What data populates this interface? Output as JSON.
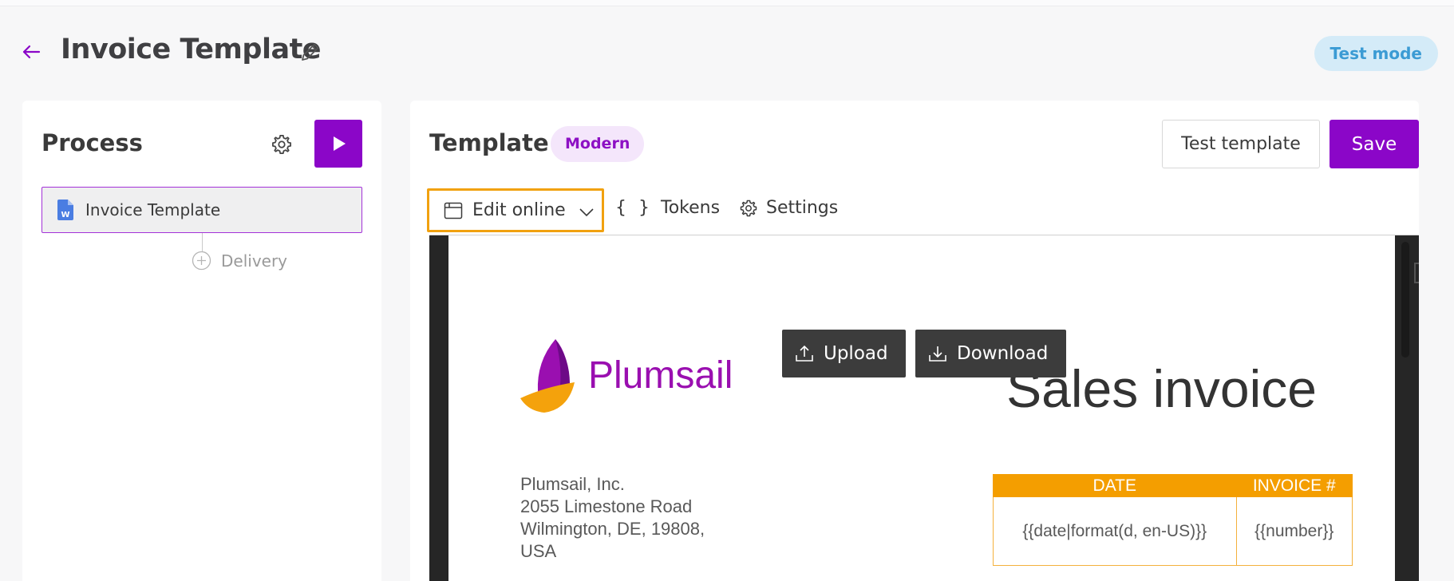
{
  "header": {
    "title": "Invoice Template",
    "test_mode_label": "Test mode"
  },
  "process": {
    "title": "Process",
    "items": [
      {
        "label": "Invoice Template",
        "icon": "word-doc-icon"
      }
    ],
    "delivery_label": "Delivery"
  },
  "template": {
    "title": "Template",
    "style_badge": "Modern",
    "test_button": "Test template",
    "save_button": "Save",
    "tabs": [
      {
        "label": "Edit online",
        "icon": "window-icon",
        "selected": true
      },
      {
        "label": "Tokens",
        "icon": "braces-icon"
      },
      {
        "label": "Settings",
        "icon": "gear-icon"
      }
    ]
  },
  "document": {
    "logo_text": "Plumsail",
    "heading": "Sales invoice",
    "upload_label": "Upload",
    "download_label": "Download",
    "address_lines": [
      "Plumsail, Inc.",
      "2055 Limestone Road",
      "Wilmington, DE, 19808,",
      "USA"
    ],
    "table": {
      "headers": [
        "DATE",
        "INVOICE #"
      ],
      "row": [
        "{{date|format(d, en-US)}}",
        "{{number}}"
      ]
    }
  },
  "colors": {
    "accent_purple": "#8b06c8",
    "highlight_orange": "#f1a10f",
    "table_orange": "#f49e00",
    "test_badge_bg": "#d4ebf8"
  }
}
